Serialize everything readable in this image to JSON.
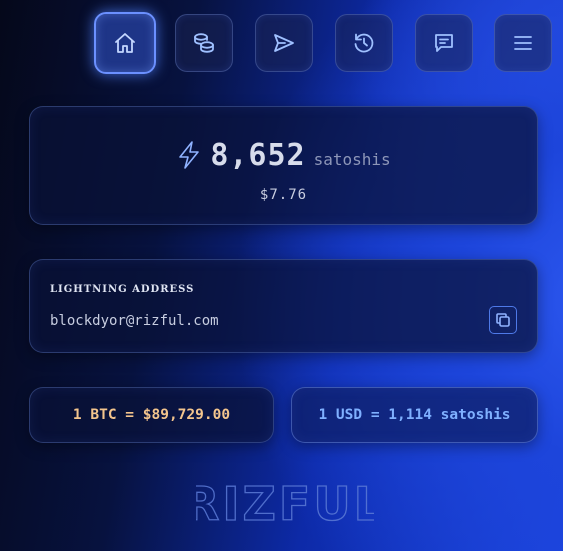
{
  "nav": {
    "items": [
      {
        "icon": "home-icon",
        "active": true
      },
      {
        "icon": "coins-icon",
        "active": false
      },
      {
        "icon": "send-icon",
        "active": false
      },
      {
        "icon": "history-icon",
        "active": false
      },
      {
        "icon": "chat-icon",
        "active": false
      },
      {
        "icon": "menu-icon",
        "active": false
      }
    ]
  },
  "balance": {
    "icon": "lightning-bolt-icon",
    "amount": "8,652",
    "unit": "satoshis",
    "fiat": "$7.76"
  },
  "lightning_address": {
    "label": "LIGHTNING ADDRESS",
    "value": "blockdyor@rizful.com",
    "copy_icon": "copy-icon"
  },
  "rates": {
    "btc": "1 BTC = $89,729.00",
    "usd": "1 USD = 1,114 satoshis"
  },
  "brand": {
    "logo_text": "RIZFUL"
  },
  "colors": {
    "accent": "#6b90ff",
    "btc_rate": "#f3c58d",
    "usd_rate": "#7fb0ff",
    "background": "#1d45db"
  }
}
